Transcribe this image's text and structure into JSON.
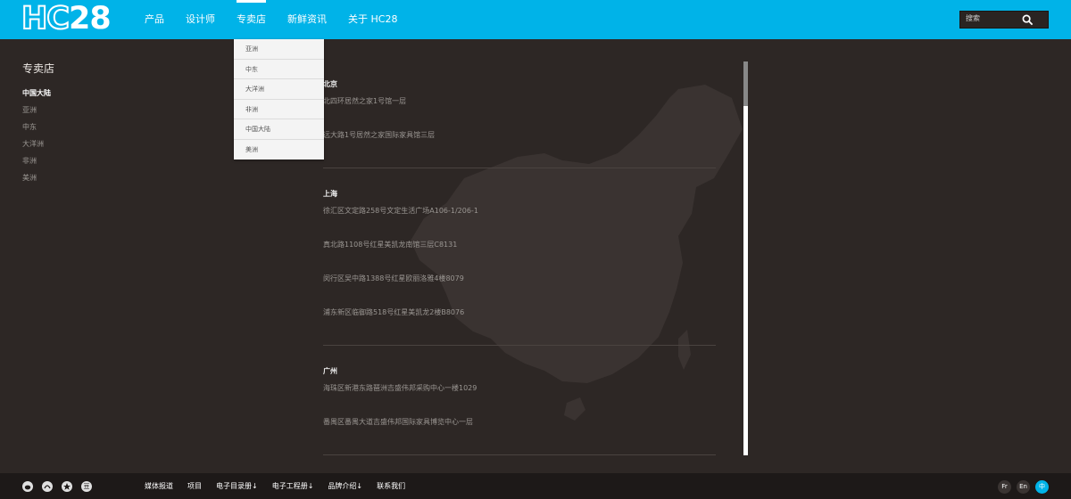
{
  "header": {
    "logo_hc": "HC",
    "logo_num": "28",
    "nav": [
      "产品",
      "设计师",
      "专卖店",
      "新鲜资讯",
      "关于 HC28"
    ],
    "active_nav_index": 2,
    "search_placeholder": "搜索",
    "search_icon": "search-icon"
  },
  "dropdown": {
    "items": [
      "亚洲",
      "中东",
      "大洋洲",
      "非洲",
      "中国大陆",
      "美洲"
    ]
  },
  "sidebar": {
    "title": "专卖店",
    "items": [
      "中国大陆",
      "亚洲",
      "中东",
      "大洋洲",
      "非洲",
      "美洲"
    ],
    "active_index": 0
  },
  "stores": [
    {
      "city": "北京",
      "addresses": [
        "北四环居然之家1号馆一层",
        "远大路1号居然之家国际家具馆三层"
      ]
    },
    {
      "city": "上海",
      "addresses": [
        "徐汇区文定路258号文定生活广场A106-1/206-1",
        "真北路1108号红星美凯龙南馆三层C8131",
        "闵行区吴中路1388号红星欧丽洛雅4楼8079",
        "浦东新区临御路518号红星美凯龙2楼B8076"
      ]
    },
    {
      "city": "广州",
      "addresses": [
        "海珠区新港东路琶洲吉盛伟邦采购中心一楼1029",
        "番禺区番禺大道吉盛伟邦国际家具博览中心一层"
      ]
    }
  ],
  "footer": {
    "social_icons": [
      "weibo-icon",
      "social-icon",
      "star-icon",
      "douban-icon"
    ],
    "douban_label": "豆",
    "links": [
      "媒体报道",
      "项目",
      "电子目录册↓",
      "电子工程册↓",
      "品牌介绍↓",
      "联系我们"
    ],
    "languages": [
      "Fr",
      "En",
      "中"
    ],
    "active_language_index": 2
  },
  "colors": {
    "brand": "#00b3e8",
    "background": "#2d2725",
    "footer": "#1d1918"
  }
}
